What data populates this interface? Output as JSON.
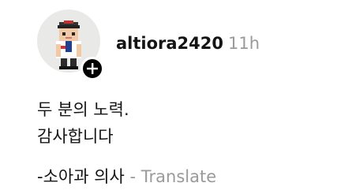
{
  "post": {
    "username": "altiora2420",
    "time": "11h",
    "lines": [
      "두 분의 노력.",
      "감사합니다"
    ],
    "signature": "-소아과 의사",
    "separator": " - ",
    "translate_label": "Translate"
  },
  "colors": {
    "text": "#141414",
    "muted": "#9a9a9a",
    "badge": "#000000"
  },
  "icons": {
    "avatar": "pixel-art-doctor-avatar",
    "follow": "plus-icon"
  }
}
